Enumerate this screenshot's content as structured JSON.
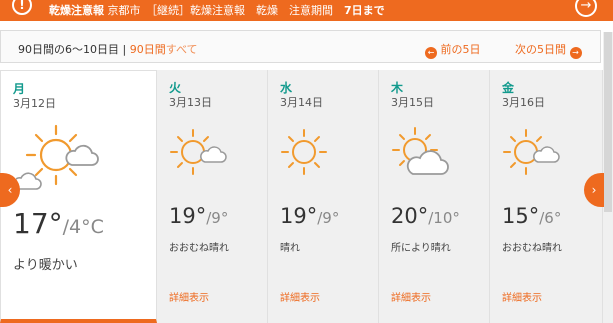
{
  "alert": {
    "warning_symbol": "!",
    "title": "乾燥注意報",
    "region": "京都市",
    "body": "［継続］乾燥注意報　乾燥　注意期間",
    "period": "7日まで",
    "go_symbol": "→"
  },
  "nav": {
    "range_label": "90日間の6～10日目",
    "separator": "|",
    "all_label": "90日間",
    "all_suffix": "すべて",
    "prev_label": "前の5日",
    "next_label": "次の5日間",
    "prev_symbol": "←",
    "next_symbol": "→"
  },
  "days": [
    {
      "dow": "月",
      "date": "3月12日",
      "high": "17°",
      "low": "/4°C",
      "desc": "より暖かい",
      "icon": "sun-cloud-icon",
      "today": true
    },
    {
      "dow": "火",
      "date": "3月13日",
      "high": "19°",
      "low": "/9°",
      "desc": "おおむね晴れ",
      "detail": "詳細表示",
      "icon": "sun-small-cloud-icon"
    },
    {
      "dow": "水",
      "date": "3月14日",
      "high": "19°",
      "low": "/9°",
      "desc": "晴れ",
      "detail": "詳細表示",
      "icon": "sun-icon"
    },
    {
      "dow": "木",
      "date": "3月15日",
      "high": "20°",
      "low": "/10°",
      "desc": "所により晴れ",
      "detail": "詳細表示",
      "icon": "sun-cloud-icon"
    },
    {
      "dow": "金",
      "date": "3月16日",
      "high": "15°",
      "low": "/6°",
      "desc": "おおむね晴れ",
      "detail": "詳細表示",
      "icon": "sun-small-cloud-icon"
    }
  ],
  "side_nav": {
    "left_symbol": "‹",
    "right_symbol": "›"
  },
  "colors": {
    "accent": "#ee6a1f",
    "weekday": "#129a8d"
  }
}
